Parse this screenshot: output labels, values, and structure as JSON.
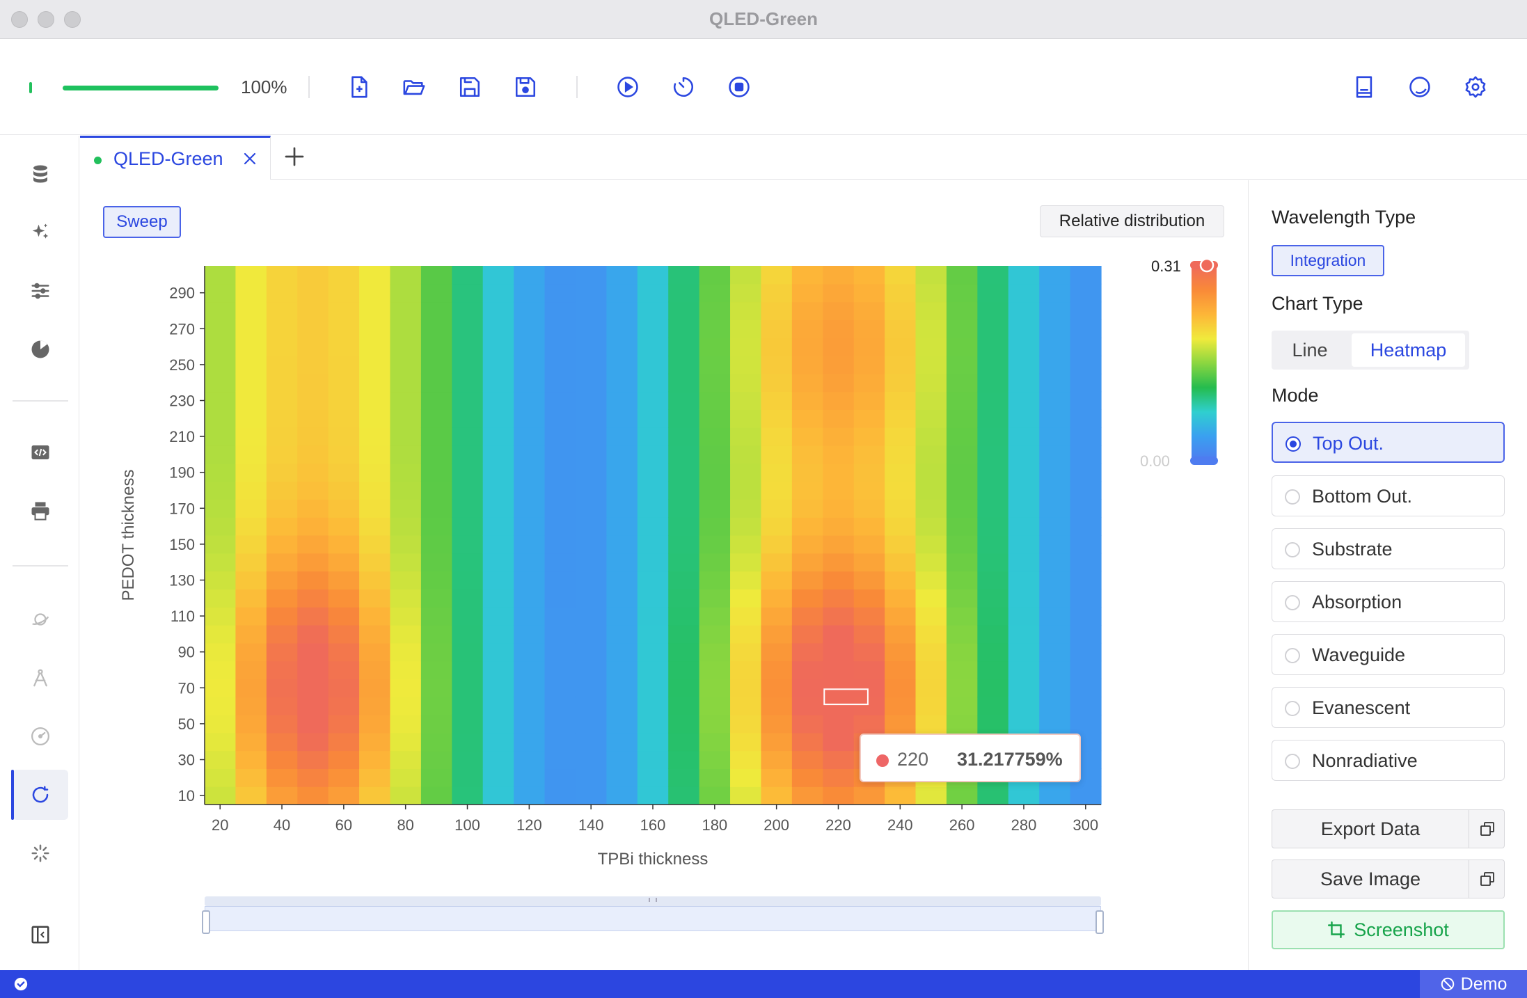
{
  "window": {
    "title": "QLED-Green"
  },
  "toolbar": {
    "progress_label": "100%",
    "progress": 1.0
  },
  "tabs": [
    {
      "label": "QLED-Green",
      "active": true
    }
  ],
  "chart_controls": {
    "sweep_label": "Sweep",
    "distribution_label": "Relative distribution"
  },
  "chart_data": {
    "type": "heatmap",
    "title": "",
    "xlabel": "TPBi thickness",
    "ylabel": "PEDOT thickness",
    "x_ticks": [
      20,
      40,
      60,
      80,
      100,
      120,
      140,
      160,
      180,
      200,
      220,
      240,
      260,
      280,
      300
    ],
    "y_ticks": [
      10,
      30,
      50,
      70,
      90,
      110,
      130,
      150,
      170,
      190,
      210,
      230,
      250,
      270,
      290
    ],
    "x_range": [
      15,
      305
    ],
    "y_range": [
      5,
      305
    ],
    "value_min": 0.0,
    "value_max": 0.31,
    "visual_map": {
      "max_label": "0.31",
      "min_label": "0.00"
    },
    "colors": [
      "#4e7cf0",
      "#3aa0f0",
      "#2fcfcf",
      "#25bc4e",
      "#8ad640",
      "#f0ea3c",
      "#fdb638",
      "#f98a38",
      "#ef6a5a"
    ],
    "tooltip": {
      "x": "220",
      "value": "31.217759%"
    },
    "highlight": {
      "x": 220,
      "y": 60
    }
  },
  "panel": {
    "wavelength_type_label": "Wavelength Type",
    "wavelength_type_value": "Integration",
    "chart_type_label": "Chart Type",
    "chart_types": [
      "Line",
      "Heatmap"
    ],
    "chart_type_selected": "Heatmap",
    "mode_label": "Mode",
    "modes": [
      "Top Out.",
      "Bottom Out.",
      "Substrate",
      "Absorption",
      "Waveguide",
      "Evanescent",
      "Nonradiative"
    ],
    "mode_selected": "Top Out.",
    "export_label": "Export Data",
    "save_label": "Save Image",
    "screenshot_label": "Screenshot"
  },
  "status": {
    "demo_label": "Demo"
  },
  "icons": {
    "toolbar": [
      "new-file-icon",
      "open-folder-icon",
      "save-icon",
      "save-as-icon",
      "play-icon",
      "timer-icon",
      "stop-icon",
      "book-icon",
      "theme-icon",
      "settings-icon"
    ],
    "sidebar": [
      "database-icon",
      "sparkle-icon",
      "sliders-icon",
      "pie-icon",
      "code-icon",
      "printer-icon",
      "planet-icon",
      "compass-icon",
      "gauge-icon",
      "refresh-icon",
      "loading-icon",
      "panel-icon"
    ]
  },
  "accent_color": "#2b47e0"
}
